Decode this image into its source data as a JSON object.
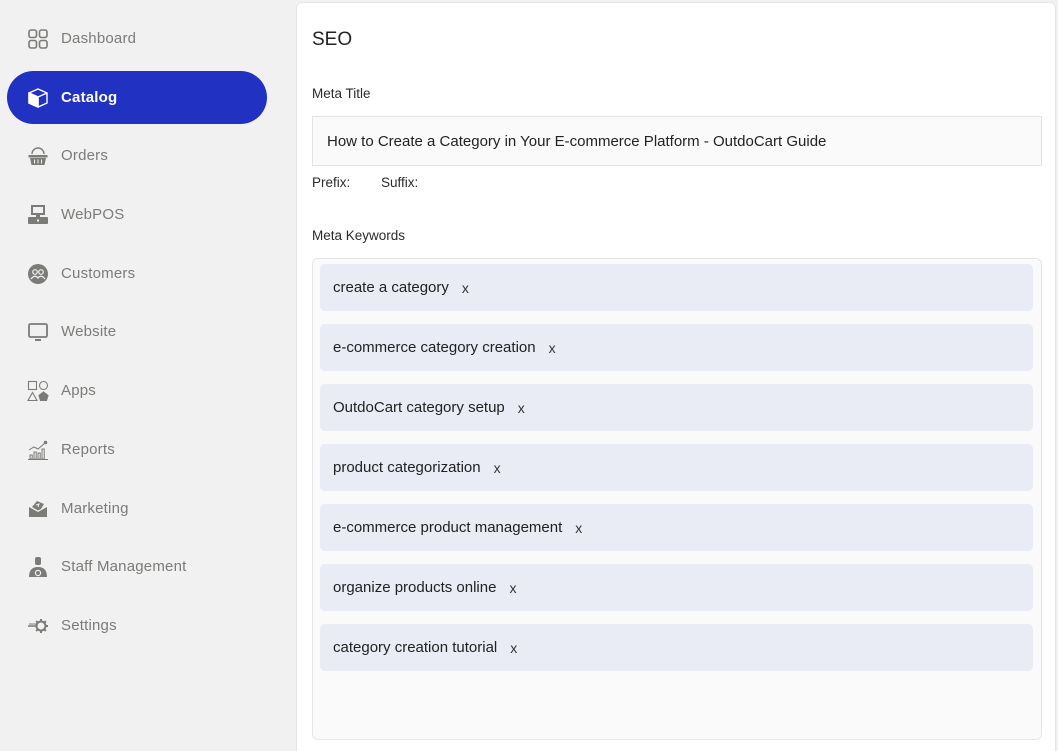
{
  "sidebar": {
    "items": [
      {
        "label": "Dashboard",
        "icon": "dashboard-grid-icon",
        "active": false
      },
      {
        "label": "Catalog",
        "icon": "box-icon",
        "active": true
      },
      {
        "label": "Orders",
        "icon": "basket-icon",
        "active": false
      },
      {
        "label": "WebPOS",
        "icon": "pos-terminal-icon",
        "active": false
      },
      {
        "label": "Customers",
        "icon": "users-circle-icon",
        "active": false
      },
      {
        "label": "Website",
        "icon": "monitor-icon",
        "active": false
      },
      {
        "label": "Apps",
        "icon": "shapes-icon",
        "active": false
      },
      {
        "label": "Reports",
        "icon": "chart-icon",
        "active": false
      },
      {
        "label": "Marketing",
        "icon": "envelope-icon",
        "active": false
      },
      {
        "label": "Staff Management",
        "icon": "staff-icon",
        "active": false
      },
      {
        "label": "Settings",
        "icon": "gear-icon",
        "active": false
      }
    ],
    "active_color": "#2131c1",
    "text_color": "#7b7b78"
  },
  "seo": {
    "title": "SEO",
    "meta_title_label": "Meta Title",
    "meta_title_value": "How to Create a Category in Your E-commerce Platform - OutdoCart Guide",
    "prefix_label": "Prefix:",
    "suffix_label": "Suffix:",
    "meta_keywords_label": "Meta Keywords",
    "remove_symbol": "x",
    "keywords": [
      "create a category",
      "e-commerce category creation",
      "OutdoCart category setup",
      "product categorization",
      "e-commerce product management",
      "organize products online",
      "category creation tutorial"
    ]
  }
}
